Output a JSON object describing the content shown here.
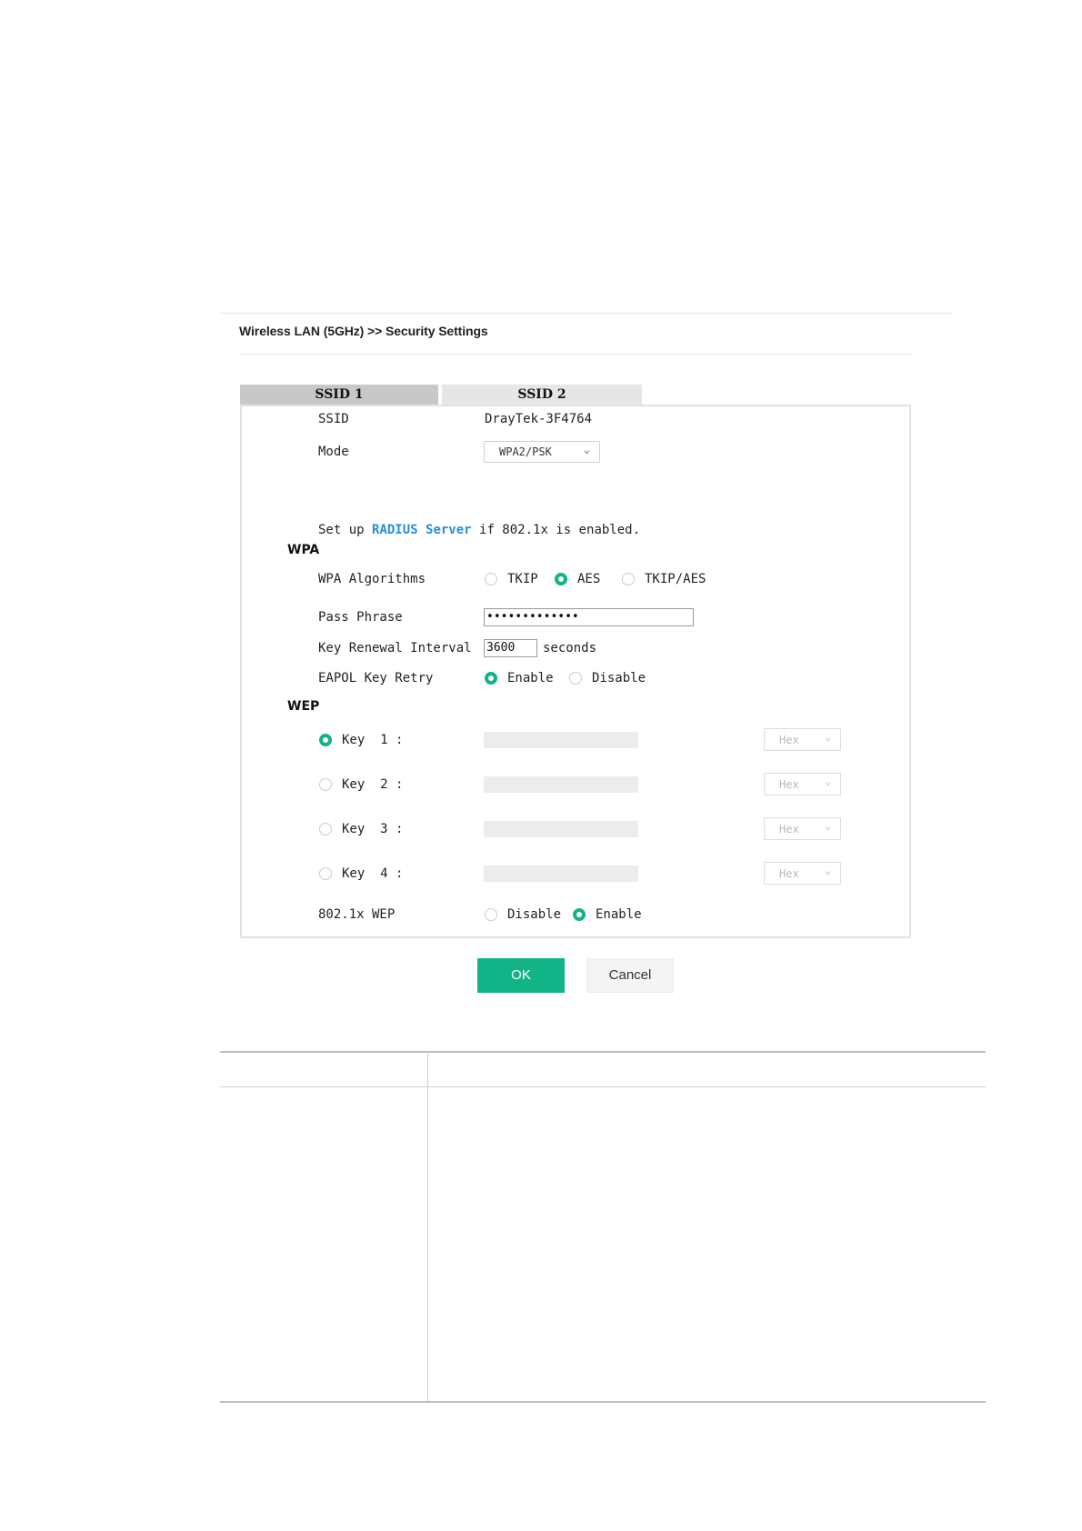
{
  "header": {
    "title": "Wireless LAN (5GHz) >> Security Settings"
  },
  "tabs": [
    {
      "label": "SSID 1",
      "active": true
    },
    {
      "label": "SSID 2",
      "active": false
    }
  ],
  "ssid": {
    "label": "SSID",
    "value": "DrayTek-3F4764"
  },
  "mode": {
    "label": "Mode",
    "value": "WPA2/PSK"
  },
  "radius_note": {
    "prefix": "Set up ",
    "link": "RADIUS Server",
    "suffix": " if 802.1x is enabled."
  },
  "wpa": {
    "section": "WPA",
    "algorithms": {
      "label": "WPA Algorithms",
      "options": [
        "TKIP",
        "AES",
        "TKIP/AES"
      ],
      "selected": "AES"
    },
    "pass_phrase": {
      "label": "Pass Phrase",
      "value": "•••••••••••••"
    },
    "key_renewal": {
      "label": "Key Renewal Interval",
      "value": "3600",
      "unit": "seconds"
    },
    "eapol": {
      "label": "EAPOL Key Retry",
      "options": [
        "Enable",
        "Disable"
      ],
      "selected": "Enable"
    }
  },
  "wep": {
    "section": "WEP",
    "keys": [
      {
        "label": "Key  1 :",
        "format": "Hex",
        "selected": true
      },
      {
        "label": "Key  2 :",
        "format": "Hex",
        "selected": false
      },
      {
        "label": "Key  3 :",
        "format": "Hex",
        "selected": false
      },
      {
        "label": "Key  4 :",
        "format": "Hex",
        "selected": false
      }
    ],
    "dot1x": {
      "label": "802.1x WEP",
      "options": [
        "Disable",
        "Enable"
      ],
      "selected": "Enable"
    }
  },
  "buttons": {
    "ok": "OK",
    "cancel": "Cancel"
  },
  "colors": {
    "accent": "#13b388",
    "link": "#2a8fd8"
  }
}
